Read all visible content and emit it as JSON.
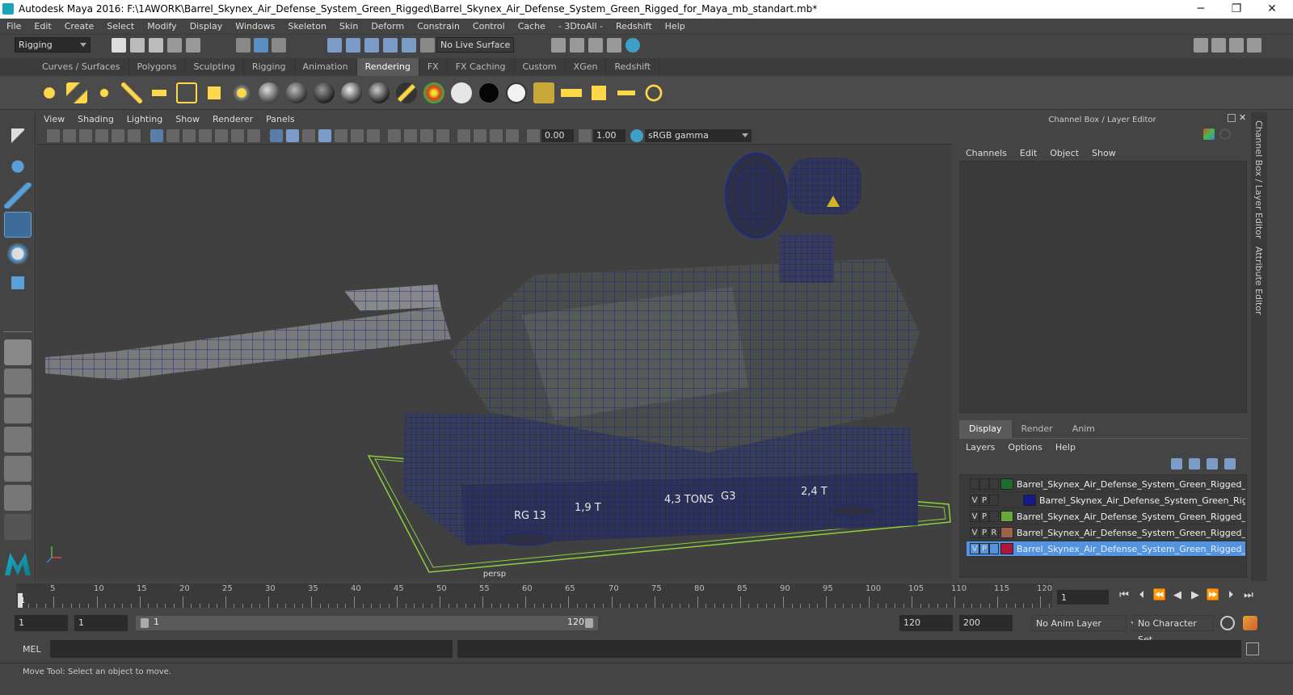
{
  "window": {
    "title": "Autodesk Maya 2016: F:\\1AWORK\\Barrel_Skynex_Air_Defense_System_Green_Rigged\\Barrel_Skynex_Air_Defense_System_Green_Rigged_for_Maya_mb_standart.mb*",
    "minimize": "─",
    "restore": "❐",
    "close": "✕"
  },
  "menubar": [
    "File",
    "Edit",
    "Create",
    "Select",
    "Modify",
    "Display",
    "Windows",
    "Skeleton",
    "Skin",
    "Deform",
    "Constrain",
    "Control",
    "Cache",
    "- 3DtoAll -",
    "Redshift",
    "Help"
  ],
  "statusbar": {
    "mode": "Rigging",
    "live_surface": "No Live Surface"
  },
  "shelf_tabs": [
    {
      "label": "Curves / Surfaces",
      "active": false
    },
    {
      "label": "Polygons",
      "active": false
    },
    {
      "label": "Sculpting",
      "active": false
    },
    {
      "label": "Rigging",
      "active": false
    },
    {
      "label": "Animation",
      "active": false
    },
    {
      "label": "Rendering",
      "active": true
    },
    {
      "label": "FX",
      "active": false
    },
    {
      "label": "FX Caching",
      "active": false
    },
    {
      "label": "Custom",
      "active": false
    },
    {
      "label": "XGen",
      "active": false
    },
    {
      "label": "Redshift",
      "active": false
    }
  ],
  "viewport": {
    "menu": [
      "View",
      "Shading",
      "Lighting",
      "Show",
      "Renderer",
      "Panels"
    ],
    "exposure": "0.00",
    "gamma": "1.00",
    "colorspace": "sRGB gamma",
    "camera": "persp",
    "decals": [
      "RG 13",
      "1,9 T",
      "4,3 TONS",
      "G3",
      "2,4 T"
    ]
  },
  "channel_box": {
    "header": "Channel Box / Layer Editor",
    "menu": [
      "Channels",
      "Edit",
      "Object",
      "Show"
    ]
  },
  "side_tabs": [
    "Channel Box / Layer Editor",
    "Attribute Editor"
  ],
  "layer_editor": {
    "tabs": [
      {
        "label": "Display",
        "active": true
      },
      {
        "label": "Render",
        "active": false
      },
      {
        "label": "Anim",
        "active": false
      }
    ],
    "menu": [
      "Layers",
      "Options",
      "Help"
    ],
    "layers": [
      {
        "v": "",
        "p": "",
        "r": "",
        "color": "#1e6b2e",
        "name": "Barrel_Skynex_Air_Defense_System_Green_Rigged_helper",
        "selected": false,
        "indent": 0
      },
      {
        "v": "V",
        "p": "P",
        "r": "",
        "color": "#141a8c",
        "name": "Barrel_Skynex_Air_Defense_System_Green_Rigged",
        "selected": false,
        "indent": 1
      },
      {
        "v": "V",
        "p": "P",
        "r": "",
        "color": "#6aa83a",
        "name": "Barrel_Skynex_Air_Defense_System_Green_Rigged_contro",
        "selected": false,
        "indent": 0
      },
      {
        "v": "V",
        "p": "P",
        "r": "R",
        "color": "#a0614a",
        "name": "Barrel_Skynex_Air_Defense_System_Green_Rigged_contro",
        "selected": false,
        "indent": 0
      },
      {
        "v": "V",
        "p": "P",
        "r": "",
        "color": "#b0163c",
        "name": "Barrel_Skynex_Air_Defense_System_Green_Rigged_bones",
        "selected": true,
        "indent": 0
      }
    ]
  },
  "timeline": {
    "ticks": [
      "5",
      "10",
      "15",
      "20",
      "25",
      "30",
      "35",
      "40",
      "45",
      "50",
      "55",
      "60",
      "65",
      "70",
      "75",
      "80",
      "85",
      "90",
      "95",
      "100",
      "105",
      "110",
      "115",
      "120"
    ],
    "start_marker": "1",
    "current_frame": "1"
  },
  "range": {
    "start": "1",
    "playback_start": "1",
    "slider_start": "1",
    "slider_end": "120",
    "playback_end": "120",
    "end": "200",
    "anim_layer": "No Anim Layer",
    "character_set": "No Character Set"
  },
  "mel": {
    "label": "MEL"
  },
  "help_line": "Move Tool: Select an object to move."
}
